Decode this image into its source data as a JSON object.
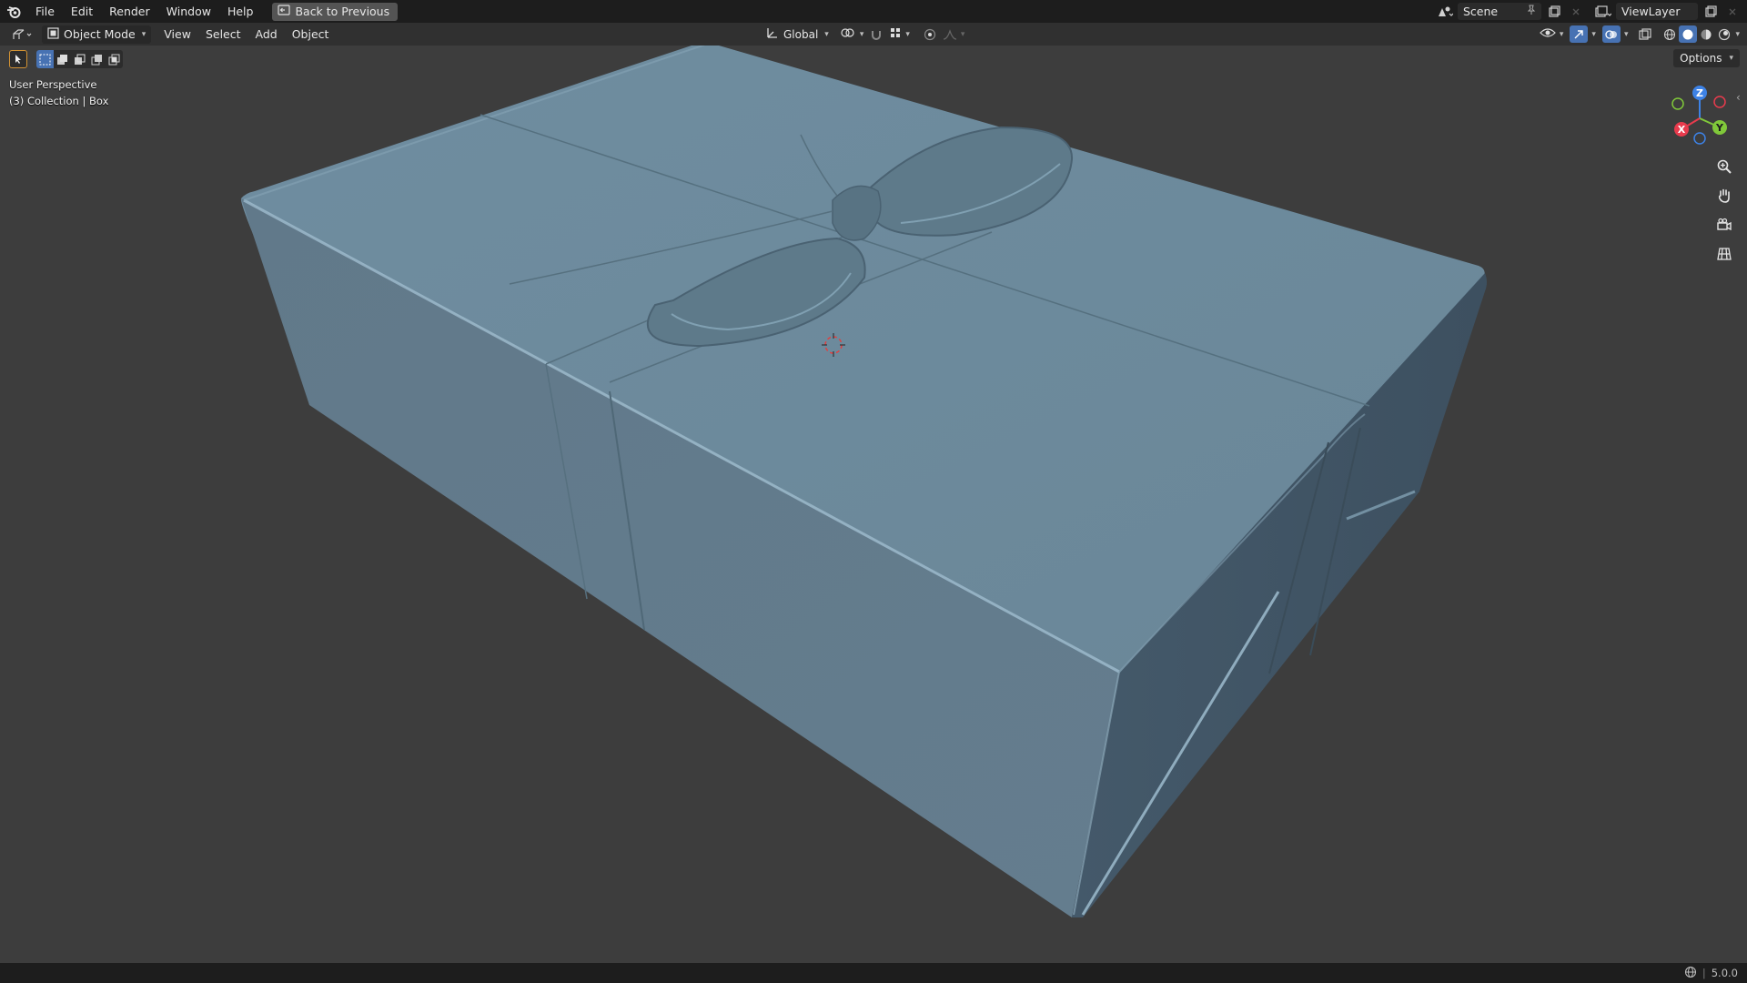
{
  "menu": {
    "file": "File",
    "edit": "Edit",
    "render": "Render",
    "window": "Window",
    "help": "Help"
  },
  "back_button": "Back to Previous",
  "scene": {
    "name": "Scene"
  },
  "view_layer": {
    "name": "ViewLayer"
  },
  "header": {
    "mode": "Object Mode",
    "view": "View",
    "select": "Select",
    "add": "Add",
    "object": "Object",
    "orientation": "Global",
    "options": "Options"
  },
  "viewport": {
    "perspective": "User Perspective",
    "collection": "(3) Collection | Box"
  },
  "gizmo": {
    "x": "X",
    "y": "Y",
    "z": "Z"
  },
  "status": {
    "version": "5.0.0"
  },
  "colors": {
    "box": "#6e8b9d",
    "background": "#3d3d3d",
    "header": "#303030",
    "topbar": "#1d1d1d",
    "axis_x": "#e83b4d",
    "axis_y": "#80c83a",
    "axis_z": "#3d82e6"
  },
  "icons": [
    "blender-logo-icon",
    "back-icon",
    "scene-icon",
    "pin-icon",
    "new-scene-icon",
    "close-icon",
    "view-layer-icon",
    "editor-type-icon",
    "object-mode-icon",
    "transform-orientation-icon",
    "pivot-icon",
    "snap-icon",
    "proportional-edit-icon",
    "visibility-icon",
    "gizmo-icon",
    "overlay-icon",
    "xray-icon",
    "wireframe-shading-icon",
    "solid-shading-icon",
    "material-shading-icon",
    "rendered-shading-icon",
    "select-tool-icon",
    "zoom-icon",
    "hand-pan-icon",
    "camera-icon",
    "grid-icon",
    "network-icon"
  ]
}
